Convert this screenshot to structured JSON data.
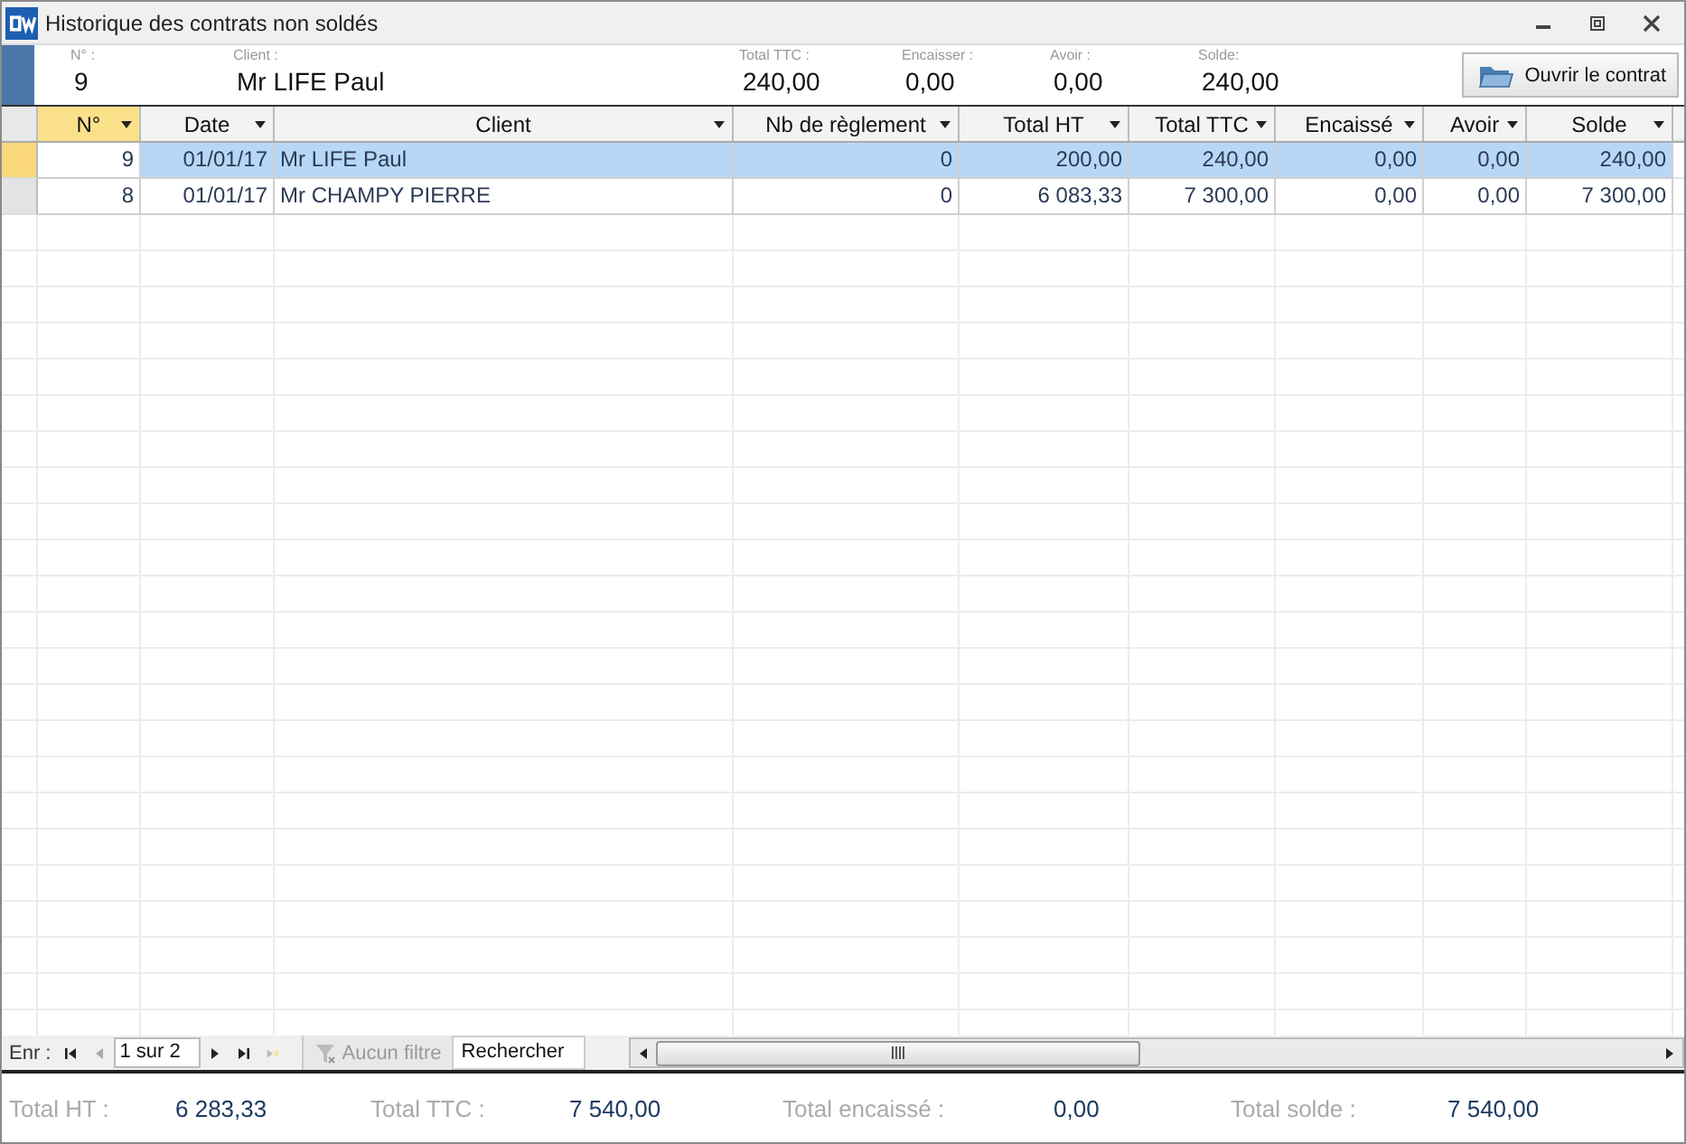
{
  "window": {
    "title": "Historique des contrats non soldés"
  },
  "header": {
    "fields": [
      {
        "label": "N° :",
        "value": "9"
      },
      {
        "label": "Client :",
        "value": "Mr LIFE Paul"
      },
      {
        "label": "Total TTC :",
        "value": "240,00"
      },
      {
        "label": "Encaisser :",
        "value": "0,00"
      },
      {
        "label": "Avoir :",
        "value": "0,00"
      },
      {
        "label": "Solde:",
        "value": "240,00"
      }
    ],
    "button": "Ouvrir le contrat"
  },
  "table": {
    "columns": [
      {
        "label": "N°",
        "active": true
      },
      {
        "label": "Date",
        "active": false
      },
      {
        "label": "Client",
        "active": false
      },
      {
        "label": "Nb de règlement",
        "active": false
      },
      {
        "label": "Total HT",
        "active": false
      },
      {
        "label": "Total TTC",
        "active": false
      },
      {
        "label": "Encaissé",
        "active": false
      },
      {
        "label": "Avoir",
        "active": false
      },
      {
        "label": "Solde",
        "active": false
      }
    ],
    "rows": [
      {
        "selected": true,
        "cells": [
          "9",
          "01/01/17",
          "Mr LIFE Paul",
          "0",
          "200,00",
          "240,00",
          "0,00",
          "0,00",
          "240,00"
        ]
      },
      {
        "selected": false,
        "cells": [
          "8",
          "01/01/17",
          "Mr CHAMPY PIERRE",
          "0",
          "6 083,33",
          "7 300,00",
          "0,00",
          "0,00",
          "7 300,00"
        ]
      }
    ]
  },
  "navigator": {
    "label": "Enr :",
    "position": "1 sur 2",
    "filter": {
      "label": "Aucun filtre",
      "disabled": true
    },
    "search": "Rechercher"
  },
  "totals": [
    {
      "label": "Total HT :",
      "value": "6 283,33"
    },
    {
      "label": "Total TTC :",
      "value": "7 540,00"
    },
    {
      "label": "Total encaissé :",
      "value": "0,00"
    },
    {
      "label": "Total solde :",
      "value": "7 540,00"
    }
  ]
}
